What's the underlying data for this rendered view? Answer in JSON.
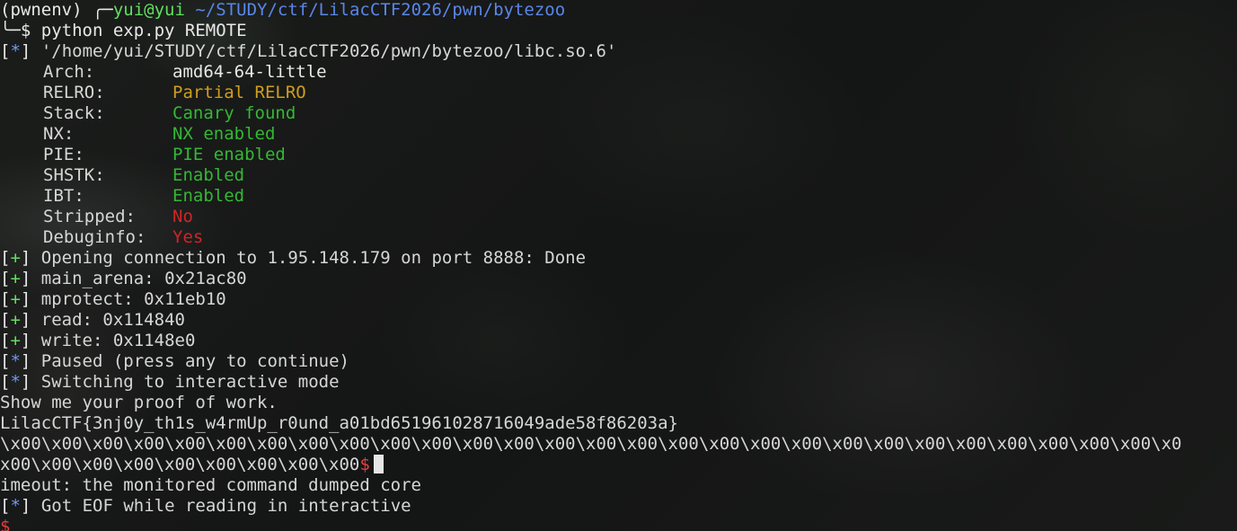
{
  "prompt": {
    "venv": "(pwnenv)",
    "corner": " ╭─",
    "user_host": "yui@yui",
    "path": "~/STUDY/ctf/LilacCTF2026/pwn/bytezoo",
    "corner2": "╰─$",
    "command": "python exp.py REMOTE"
  },
  "checksec": {
    "bracket_open": "[",
    "symbol": "*",
    "bracket_close": "]",
    "file": "'/home/yui/STUDY/ctf/LilacCTF2026/pwn/bytezoo/libc.so.6'",
    "rows": [
      {
        "key": "Arch:",
        "value": "amd64-64-little",
        "color": "#e8e8e8"
      },
      {
        "key": "RELRO:",
        "value": "Partial RELRO",
        "color": "#cf9e1c"
      },
      {
        "key": "Stack:",
        "value": "Canary found",
        "color": "#35b735"
      },
      {
        "key": "NX:",
        "value": "NX enabled",
        "color": "#35b735"
      },
      {
        "key": "PIE:",
        "value": "PIE enabled",
        "color": "#35b735"
      },
      {
        "key": "SHSTK:",
        "value": "Enabled",
        "color": "#35b735"
      },
      {
        "key": "IBT:",
        "value": "Enabled",
        "color": "#35b735"
      },
      {
        "key": "Stripped:",
        "value": "No",
        "color": "#d02525"
      },
      {
        "key": "Debuginfo:",
        "value": "Yes",
        "color": "#d02525"
      }
    ]
  },
  "log": [
    {
      "symbol": "+",
      "text": "Opening connection to 1.95.148.179 on port 8888: Done"
    },
    {
      "symbol": "+",
      "text": "main_arena: 0x21ac80"
    },
    {
      "symbol": "+",
      "text": "mprotect: 0x11eb10"
    },
    {
      "symbol": "+",
      "text": "read: 0x114840"
    },
    {
      "symbol": "+",
      "text": "write: 0x1148e0"
    },
    {
      "symbol": "*",
      "text": "Paused (press any to continue)"
    },
    {
      "symbol": "*",
      "text": "Switching to interactive mode"
    }
  ],
  "output": {
    "pow": "Show me your proof of work.",
    "flag": "LilacCTF{3nj0y_th1s_w4rmUp_r0und_a01bd651961028716049ade58f86203a}",
    "nulls_line1": "\\x00\\x00\\x00\\x00\\x00\\x00\\x00\\x00\\x00\\x00\\x00\\x00\\x00\\x00\\x00\\x00\\x00\\x00\\x00\\x00\\x00\\x00\\x00\\x00\\x00\\x00\\x00\\x00\\x0",
    "nulls_line2": "x00\\x00\\x00\\x00\\x00\\x00\\x00\\x00\\x00",
    "dollar": "$",
    "timeout": "imeout: the monitored command dumped core",
    "eof_symbol": "*",
    "eof": "Got EOF while reading in interactive",
    "last_prompt": "$"
  },
  "colors": {
    "info_bracket": "#6f9af0",
    "plus": "#5fe05f",
    "text": "#d6d6d6",
    "background": "#161716"
  }
}
